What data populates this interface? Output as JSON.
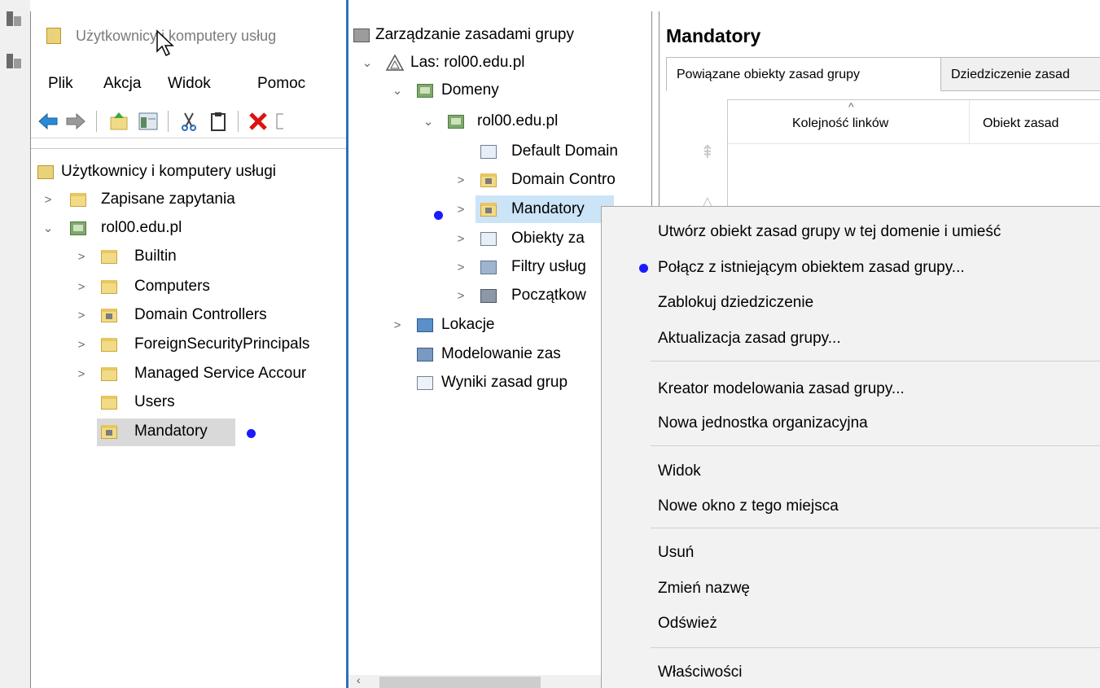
{
  "aduc": {
    "title": "Użytkownicy i komputery usług",
    "menu": [
      "Plik",
      "Akcja",
      "Widok",
      "Pomoc"
    ],
    "tree": {
      "root": "Użytkownicy i komputery usługi",
      "saved_queries": "Zapisane zapytania",
      "domain": "rol00.edu.pl",
      "children": [
        "Builtin",
        "Computers",
        "Domain Controllers",
        "ForeignSecurityPrincipals",
        "Managed Service Accour",
        "Users",
        "Mandatory"
      ]
    }
  },
  "gpmc": {
    "root": "Zarządzanie zasadami grupy",
    "forest": "Las: rol00.edu.pl",
    "domains": "Domeny",
    "domain": "rol00.edu.pl",
    "domain_children": [
      "Default Domain",
      "Domain Contro",
      "Mandatory",
      "Obiekty za",
      "Filtry usług",
      "Początkow"
    ],
    "sites": "Lokacje",
    "modeling": "Modelowanie zas",
    "results": "Wyniki zasad grup"
  },
  "detail": {
    "title": "Mandatory",
    "tabs": [
      "Powiązane obiekty zasad grupy",
      "Dziedziczenie zasad"
    ],
    "columns": [
      "Kolejność linków",
      "Obiekt zasad"
    ]
  },
  "context_menu": {
    "items": [
      "Utwórz obiekt zasad grupy w tej domenie i umieść",
      "Połącz z istniejącym obiektem zasad grupy...",
      "Zablokuj dziedziczenie",
      "Aktualizacja zasad grupy...",
      "Kreator modelowania zasad grupy...",
      "Nowa jednostka organizacyjna",
      "Widok",
      "Nowe okno z tego miejsca",
      "Usuń",
      "Zmień nazwę",
      "Odśwież",
      "Właściwości"
    ]
  },
  "colors": {
    "marker_dot": "#1a1aff",
    "divider": "#2e6fbd",
    "selected_bg": "#d9d9d9",
    "menu_bg": "#f2f2f2"
  }
}
